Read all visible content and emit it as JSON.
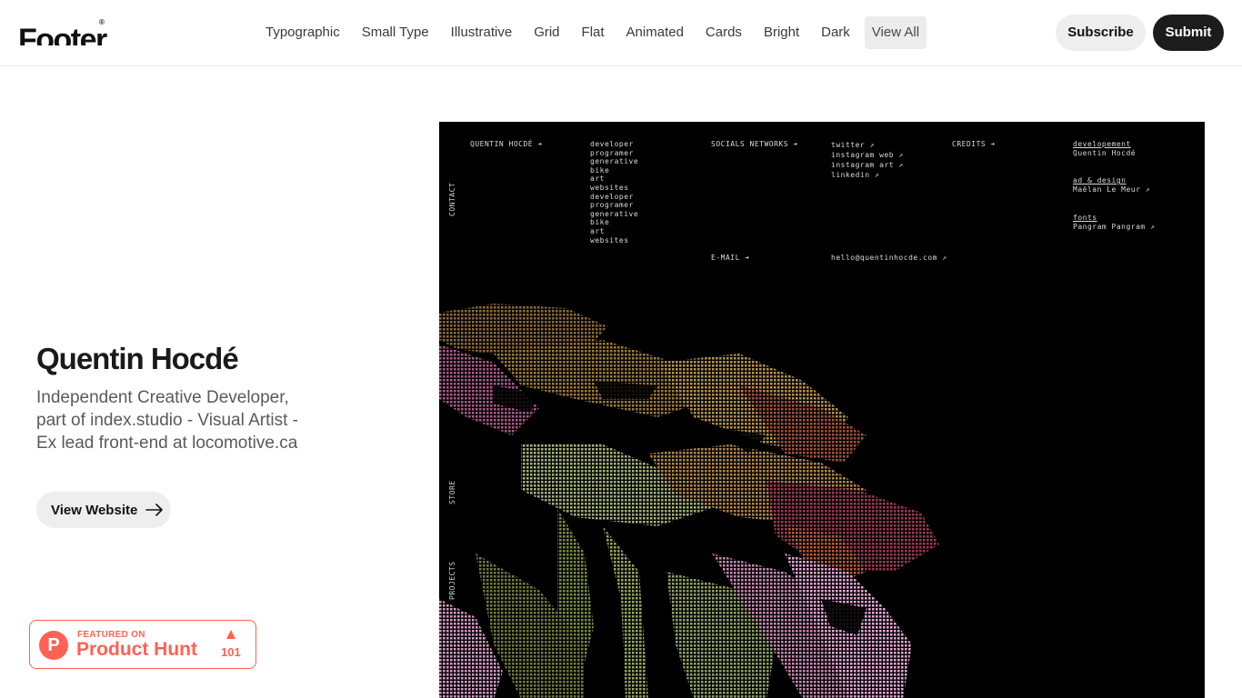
{
  "header": {
    "logo": "Footer",
    "logo_mark": "®",
    "nav": [
      {
        "label": "Typographic"
      },
      {
        "label": "Small Type"
      },
      {
        "label": "Illustrative"
      },
      {
        "label": "Grid"
      },
      {
        "label": "Flat"
      },
      {
        "label": "Animated"
      },
      {
        "label": "Cards"
      },
      {
        "label": "Bright"
      },
      {
        "label": "Dark"
      },
      {
        "label": "View All"
      }
    ],
    "active_nav": "View All",
    "subscribe_label": "Subscribe",
    "submit_label": "Submit"
  },
  "site": {
    "title": "Quentin Hocdé",
    "description": "Independent Creative Developer, part of index.studio - Visual Artist - Ex lead front-end at locomotive.ca",
    "view_label": "View Website"
  },
  "badge": {
    "featured": "FEATURED ON",
    "name": "Product Hunt",
    "letter": "P",
    "count": "101"
  },
  "preview": {
    "name_heading": "QUENTIN HOCDÉ ➔",
    "roles": [
      "developer",
      "programer",
      "generative",
      "bike",
      "art",
      "websites",
      "developer",
      "programer",
      "generative",
      "bike",
      "art",
      "websites"
    ],
    "socials_heading": "SOCIALS NETWORKS ➔",
    "socials": [
      "twitter ↗",
      "instagram web ↗",
      "instagram art ↗",
      "linkedin ↗"
    ],
    "credits_heading": "CREDITS ➔",
    "credit_dev_label": "developement",
    "credit_dev_name": "Quentin Hocdé",
    "credit_design_label": "ad & design",
    "credit_design_name": "Maëlan Le Meur ↗",
    "credit_fonts_label": "fonts",
    "credit_fonts_name": "Pangram Pangram ↗",
    "email_heading": "E-MAIL ➔",
    "email": "hello@quentinhocde.com ↗",
    "side_labels": [
      "CONTACT",
      "STORE",
      "PROJECTS"
    ]
  },
  "colors": {
    "accent_dark": "#1c1c1c",
    "pill_bg": "#eeeeee",
    "product_hunt": "#ff6154"
  }
}
